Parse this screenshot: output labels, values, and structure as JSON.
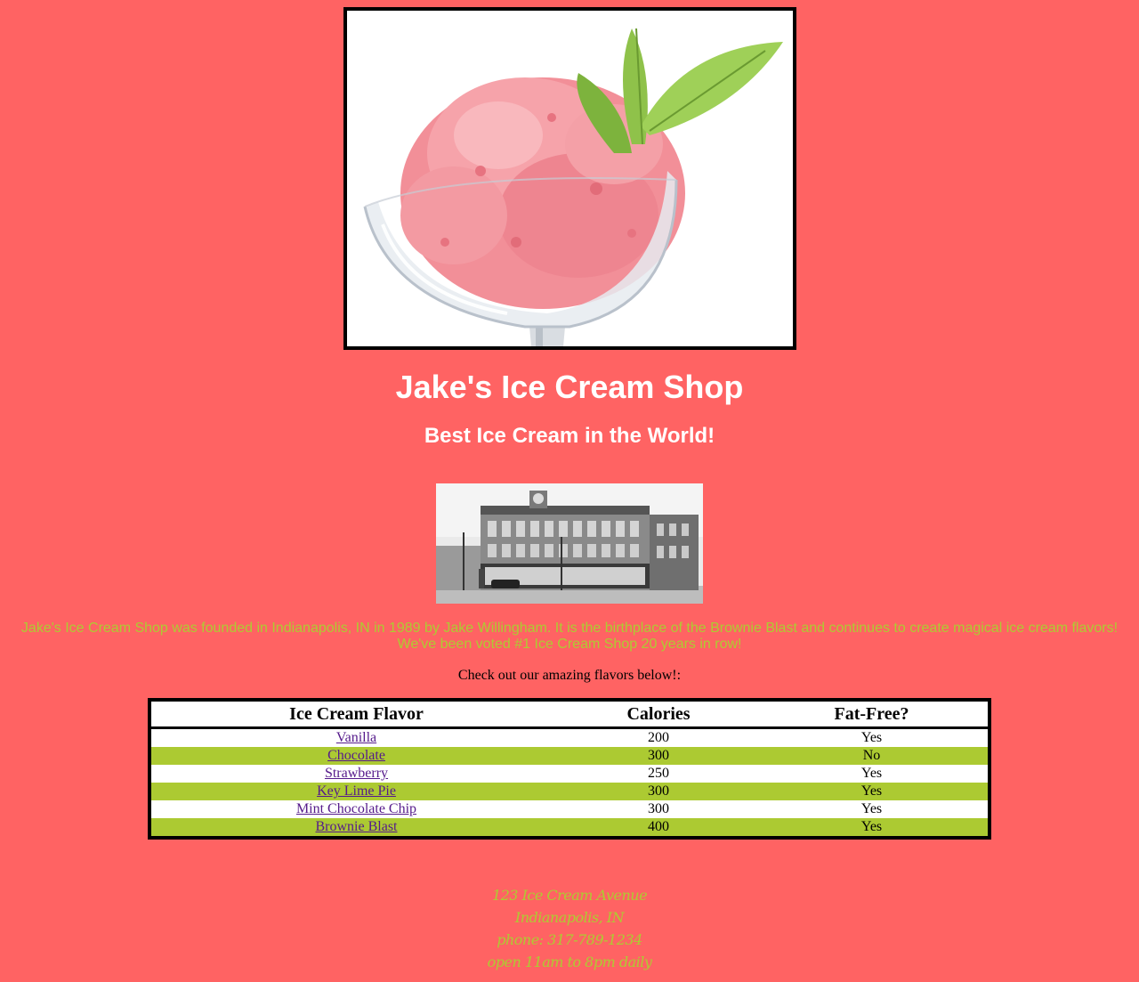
{
  "header": {
    "title": "Jake's Ice Cream Shop",
    "subtitle": "Best Ice Cream in the World!"
  },
  "about": {
    "line1": "Jake's Ice Cream Shop was founded in Indianapolis, IN in 1989 by Jake Willingham. It is the birthplace of the Brownie Blast and continues to create magical ice cream flavors!",
    "line2": "We've been voted #1 Ice Cream Shop 20 years in row!"
  },
  "intro": "Check out our amazing flavors below!:",
  "table": {
    "headers": [
      "Ice Cream Flavor",
      "Calories",
      "Fat-Free?"
    ],
    "rows": [
      {
        "flavor": "Vanilla",
        "calories": "200",
        "fat_free": "Yes"
      },
      {
        "flavor": "Chocolate",
        "calories": "300",
        "fat_free": "No"
      },
      {
        "flavor": "Strawberry",
        "calories": "250",
        "fat_free": "Yes"
      },
      {
        "flavor": "Key Lime Pie",
        "calories": "300",
        "fat_free": "Yes"
      },
      {
        "flavor": "Mint Chocolate Chip",
        "calories": "300",
        "fat_free": "Yes"
      },
      {
        "flavor": "Brownie Blast",
        "calories": "400",
        "fat_free": "Yes"
      }
    ]
  },
  "footer": {
    "address": "123 Ice Cream Avenue",
    "city": "Indianapolis, IN",
    "phone": "phone: 317-789-1234",
    "hours": "open 11am to 8pm daily"
  },
  "colors": {
    "page_background": "#ff6363",
    "accent_green": "#acca32",
    "heading_white": "#ffffff",
    "link_visited": "#551a8b"
  }
}
